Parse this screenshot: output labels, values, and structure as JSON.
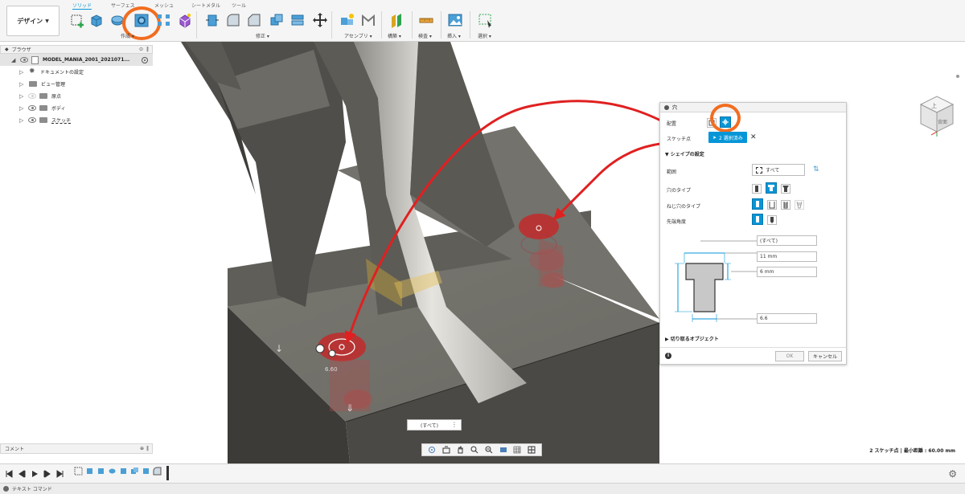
{
  "toolbar": {
    "workspace_button": "デザイン",
    "tabs": {
      "solid": "ソリッド",
      "surface": "サーフェス",
      "mesh": "メッシュ",
      "sheet_metal": "シートメタル",
      "tools": "ツール"
    },
    "groups": {
      "create": "作成",
      "modify": "修正",
      "assemble": "アセンブリ",
      "construct": "構築",
      "inspect": "検査",
      "insert": "挿入",
      "select": "選択"
    }
  },
  "browser": {
    "title": "ブラウザ",
    "items": [
      {
        "label": "MODEL_MANIA_2001_2021071...",
        "kind": "root"
      },
      {
        "label": "ドキュメントの設定",
        "kind": "settings"
      },
      {
        "label": "ビュー管理",
        "kind": "folder"
      },
      {
        "label": "原点",
        "kind": "folder"
      },
      {
        "label": "ボディ",
        "kind": "folder"
      },
      {
        "label": "スケッチ",
        "kind": "folder"
      }
    ]
  },
  "comments": {
    "title": "コメント"
  },
  "hole_panel": {
    "title": "穴",
    "placement_label": "配置",
    "sketch_point_label": "スケッチ点",
    "selection_text": "2 選択済み",
    "shape_settings_label": "シェイプの設定",
    "extent_label": "範囲",
    "extent_value": "すべて",
    "hole_type_label": "穴のタイプ",
    "thread_type_label": "ねじ穴のタイプ",
    "drill_point_label": "先端角度",
    "dim_extent": "(すべて)",
    "dim_diameter_cb": "11 mm",
    "dim_depth_cb": "6 mm",
    "dim_diameter": "6.6",
    "objects_to_cut_label": "切り取るオブジェクト",
    "ok": "OK",
    "cancel": "キャンセル"
  },
  "viewport": {
    "extent_mini": "(すべて)",
    "status": "2 スケッチ点 | 最小距離 : 60.00 mm",
    "viewcube_top": "上",
    "viewcube_back": "背面",
    "hole_dim_text": "6.60"
  },
  "text_command": {
    "label": "テキスト コマンド"
  },
  "colors": {
    "accent": "#0696d7",
    "highlight_circle": "#f26d21",
    "annotation_arrow": "#e02020",
    "hole_preview": "#c22a2a"
  }
}
